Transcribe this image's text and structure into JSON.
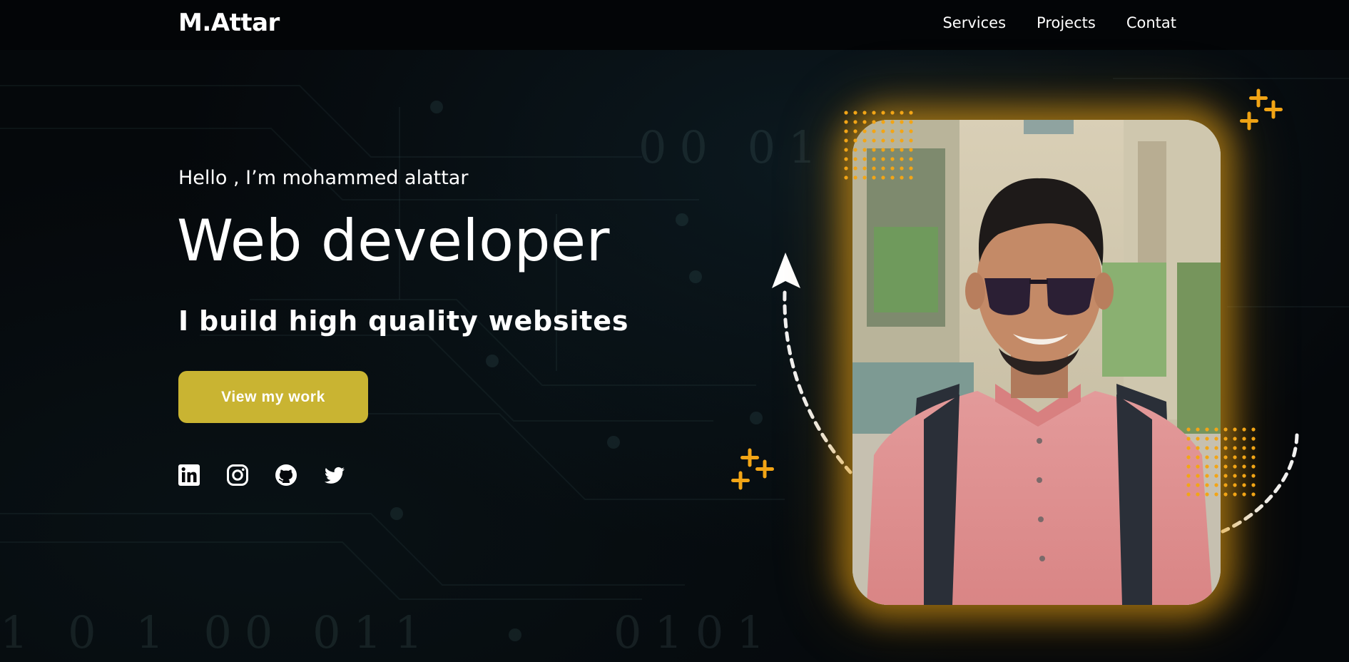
{
  "header": {
    "logo": "M.Attar",
    "nav": [
      "Services",
      "Projects",
      "Contat"
    ]
  },
  "hero": {
    "greeting": "Hello , I’m mohammed alattar",
    "role": "Web developer",
    "tagline": "I build high quality websites",
    "cta_label": "View my work",
    "socials": [
      "linkedin-icon",
      "instagram-icon",
      "github-icon",
      "twitter-icon"
    ]
  },
  "background": {
    "digits_top": "00   01",
    "digits_bottom_left": "1 0 1  00  011",
    "digits_bottom_mid": "0101"
  },
  "colors": {
    "accent": "#c9b432",
    "glow": "#e6a014",
    "deco": "#f2a516",
    "background": "#05080b"
  }
}
